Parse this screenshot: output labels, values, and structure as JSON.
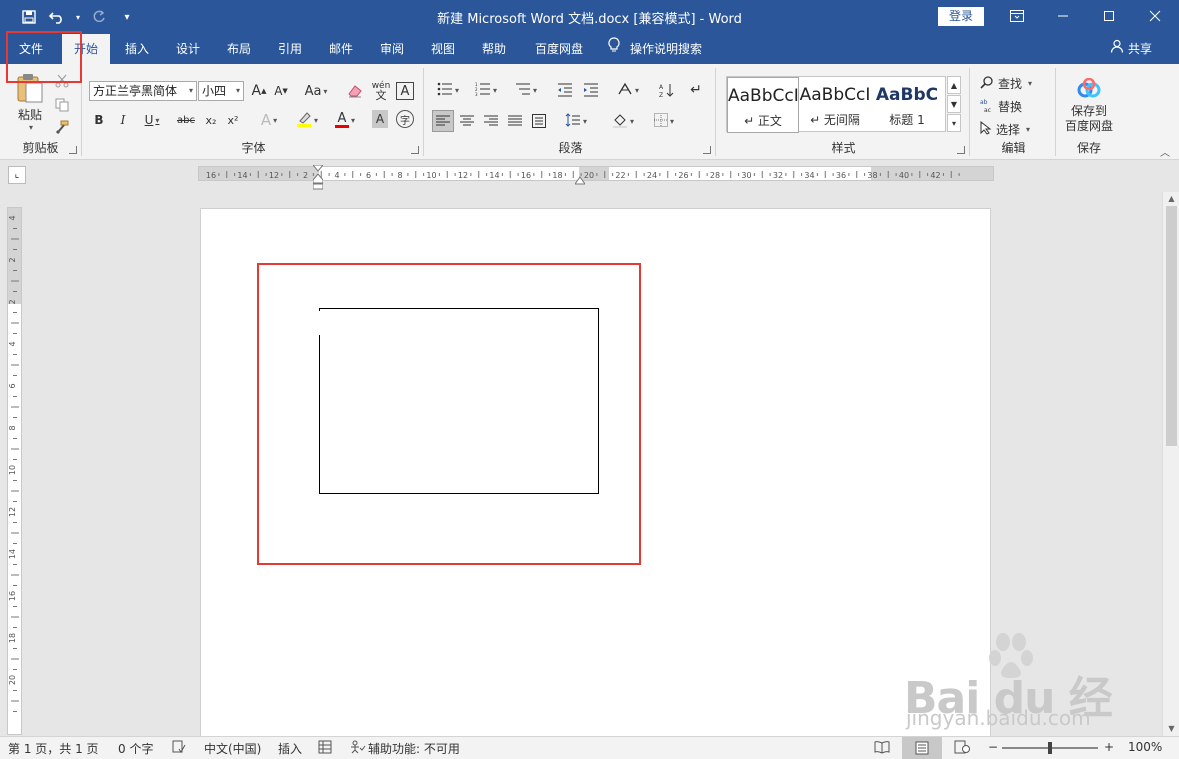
{
  "titlebar": {
    "title": "新建 Microsoft Word 文档.docx [兼容模式]  -  Word",
    "signin": "登录"
  },
  "tabs": [
    "文件",
    "开始",
    "插入",
    "设计",
    "布局",
    "引用",
    "邮件",
    "审阅",
    "视图",
    "帮助",
    "百度网盘"
  ],
  "active_tab": "开始",
  "tellme": "操作说明搜索",
  "share": "共享",
  "ribbon": {
    "clipboard": {
      "paste": "粘贴",
      "label": "剪贴板"
    },
    "font": {
      "font_name": "方正兰亭黑简体",
      "font_size": "小四",
      "label": "字体",
      "clear_format_icon": "eraser-icon",
      "bold": "B",
      "italic": "I",
      "underline": "U",
      "strike": "abc",
      "sub": "x₂",
      "sup": "x²",
      "char_a": "A",
      "grow": "A",
      "shrink": "A",
      "case": "Aa",
      "pinyin": "wén 文",
      "border_a": "A",
      "enclose": "字"
    },
    "paragraph": {
      "label": "段落"
    },
    "styles": {
      "label": "样式",
      "items": [
        {
          "sample": "AaBbCcI",
          "name": "↵ 正文"
        },
        {
          "sample": "AaBbCcI",
          "name": "↵ 无间隔"
        },
        {
          "sample": "AaBbC",
          "name": "标题 1"
        }
      ]
    },
    "editing": {
      "find": "查找",
      "replace": "替换",
      "select": "选择",
      "label": "编辑"
    },
    "save": {
      "line1": "保存到",
      "line2": "百度网盘",
      "label": "保存"
    }
  },
  "hruler_ticks": [
    "16",
    "14",
    "12",
    "2",
    "4",
    "6",
    "8",
    "10",
    "12",
    "14",
    "16",
    "18",
    "20",
    "22",
    "24",
    "26",
    "28",
    "30",
    "32",
    "34",
    "36",
    "38",
    "40",
    "42"
  ],
  "vruler_ticks": [
    "4",
    "2",
    "2",
    "4",
    "6",
    "8",
    "10",
    "12",
    "14",
    "16",
    "18",
    "20"
  ],
  "statusbar": {
    "page": "第 1 页，共 1 页",
    "words": "0 个字",
    "language": "中文(中国)",
    "mode": "插入",
    "accessibility": "辅助功能: 不可用",
    "zoom": "100%",
    "minus": "−",
    "plus": "+"
  },
  "watermark": {
    "logo": "Bai du 经验",
    "url": "jingyan.baidu.com"
  }
}
